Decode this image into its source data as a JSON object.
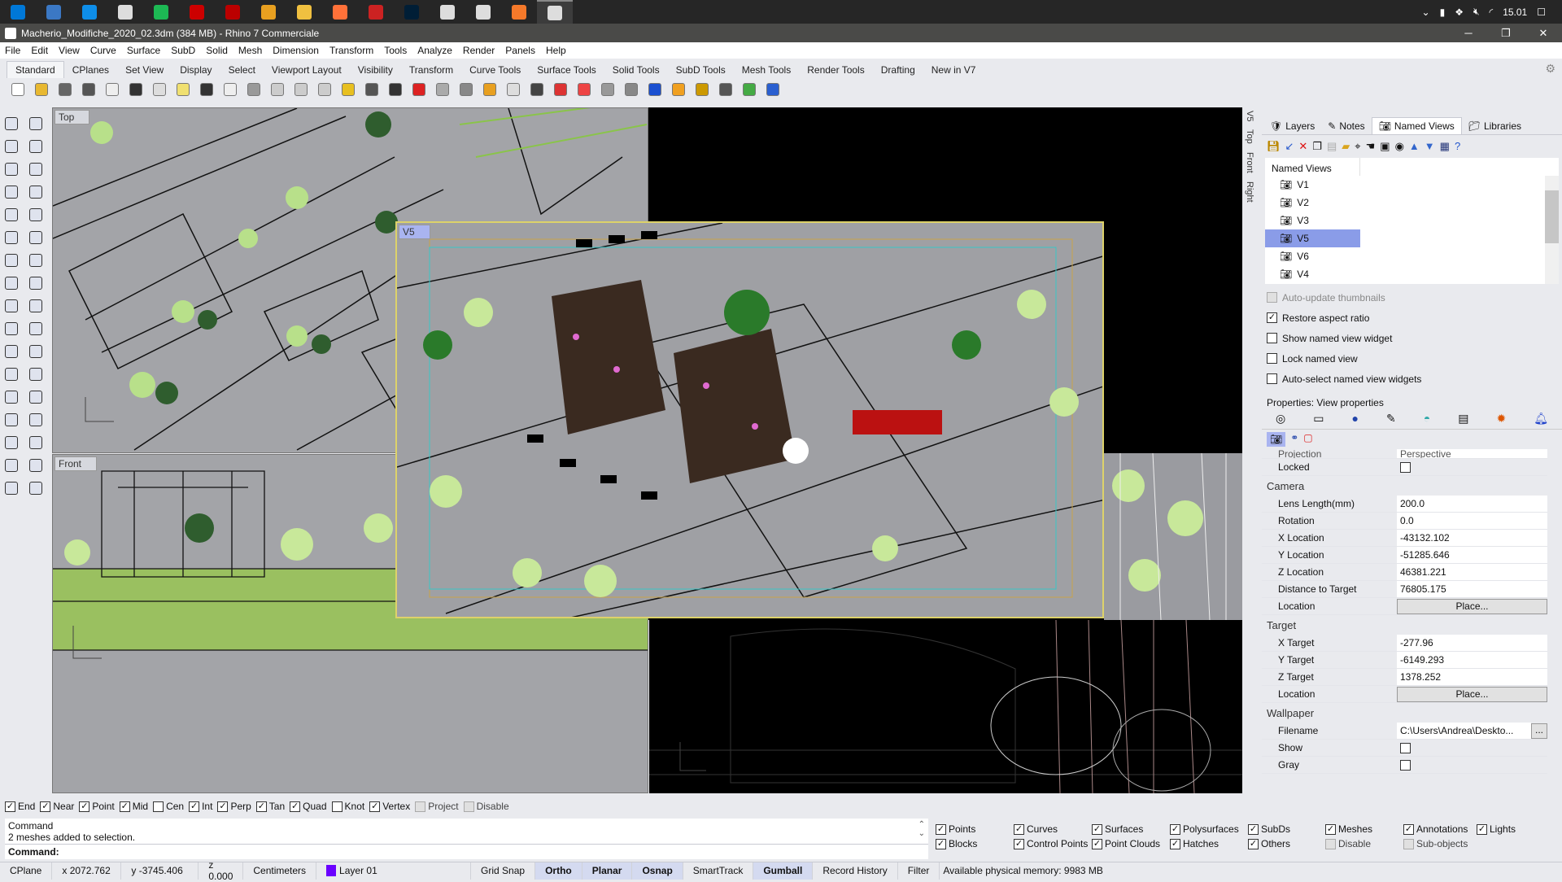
{
  "taskbar": {
    "icons": [
      "windows-start",
      "keyboard",
      "teamviewer",
      "remote-desktop",
      "spotify",
      "flash",
      "filezilla",
      "chrome",
      "file-explorer",
      "firefox",
      "rhino-render",
      "photoshop",
      "rhino-6",
      "rhino",
      "blender",
      "rhino-7"
    ],
    "tray_time": "15.01"
  },
  "window": {
    "title": "Macherio_Modifiche_2020_02.3dm (384 MB) - Rhino 7 Commerciale"
  },
  "menu": [
    "File",
    "Edit",
    "View",
    "Curve",
    "Surface",
    "SubD",
    "Solid",
    "Mesh",
    "Dimension",
    "Transform",
    "Tools",
    "Analyze",
    "Render",
    "Panels",
    "Help"
  ],
  "toolbar_tabs": [
    "Standard",
    "CPlanes",
    "Set View",
    "Display",
    "Select",
    "Viewport Layout",
    "Visibility",
    "Transform",
    "Curve Tools",
    "Surface Tools",
    "Solid Tools",
    "SubD Tools",
    "Mesh Tools",
    "Render Tools",
    "Drafting",
    "New in V7"
  ],
  "toolbar_icons": [
    "new",
    "open",
    "save",
    "print",
    "import",
    "cut",
    "copy",
    "paste",
    "undo",
    "pan",
    "rotate",
    "zoom",
    "zoom-window",
    "zoom-extents",
    "zoom-selected",
    "undo-view",
    "four-viewports",
    "car",
    "grid",
    "cplane",
    "gumball",
    "light",
    "lock",
    "layer",
    "color",
    "render-sphere",
    "shaded-sphere",
    "blue-sphere",
    "cone",
    "gear",
    "dimension",
    "globe",
    "help"
  ],
  "viewports": {
    "top": "Top",
    "front": "Front",
    "v5": "V5",
    "axis_x": "x",
    "axis_y": "y",
    "axis_z": "z"
  },
  "vertical_tabs": [
    "V5",
    "Top",
    "Front",
    "Right"
  ],
  "panel": {
    "tabs": [
      "Layers",
      "Notes",
      "Named Views",
      "Libraries"
    ],
    "list_header": "Named Views",
    "views": [
      "V1",
      "V2",
      "V3",
      "V5",
      "V6",
      "V4"
    ],
    "selected_view": "V5",
    "options": [
      {
        "label": "Auto-update thumbnails",
        "checked": false,
        "disabled": true
      },
      {
        "label": "Restore aspect ratio",
        "checked": true
      },
      {
        "label": "Show named view widget",
        "checked": false
      },
      {
        "label": "Lock named view",
        "checked": false
      },
      {
        "label": "Auto-select named view widgets",
        "checked": false
      }
    ],
    "properties_title": "Properties: View properties",
    "projection_label": "Projection",
    "projection_value": "Perspective",
    "locked_label": "Locked",
    "camera": {
      "title": "Camera",
      "lens_label": "Lens Length(mm)",
      "lens": "200.0",
      "rotation_label": "Rotation",
      "rotation": "0.0",
      "xloc_label": "X Location",
      "xloc": "-43132.102",
      "yloc_label": "Y Location",
      "yloc": "-51285.646",
      "zloc_label": "Z Location",
      "zloc": "46381.221",
      "dist_label": "Distance to Target",
      "dist": "76805.175",
      "location_label": "Location",
      "place": "Place..."
    },
    "target": {
      "title": "Target",
      "x_label": "X Target",
      "x": "-277.96",
      "y_label": "Y Target",
      "y": "-6149.293",
      "z_label": "Z Target",
      "z": "1378.252",
      "location_label": "Location",
      "place": "Place..."
    },
    "wallpaper": {
      "title": "Wallpaper",
      "filename_label": "Filename",
      "filename": "C:\\Users\\Andrea\\Deskto...",
      "browse": "...",
      "show_label": "Show",
      "gray_label": "Gray"
    }
  },
  "osnap": [
    {
      "label": "End",
      "checked": true
    },
    {
      "label": "Near",
      "checked": true
    },
    {
      "label": "Point",
      "checked": true
    },
    {
      "label": "Mid",
      "checked": true
    },
    {
      "label": "Cen",
      "checked": false
    },
    {
      "label": "Int",
      "checked": true
    },
    {
      "label": "Perp",
      "checked": true
    },
    {
      "label": "Tan",
      "checked": true
    },
    {
      "label": "Quad",
      "checked": true
    },
    {
      "label": "Knot",
      "checked": false
    },
    {
      "label": "Vertex",
      "checked": true
    },
    {
      "label": "Project",
      "checked": false,
      "disabled": true
    },
    {
      "label": "Disable",
      "checked": false,
      "disabled": true
    }
  ],
  "command": {
    "history": [
      "Command",
      "2 meshes added to selection."
    ],
    "prompt": "Command:"
  },
  "filter": [
    {
      "label": "Points",
      "checked": true
    },
    {
      "label": "Curves",
      "checked": true
    },
    {
      "label": "Surfaces",
      "checked": true
    },
    {
      "label": "Polysurfaces",
      "checked": true
    },
    {
      "label": "SubDs",
      "checked": true
    },
    {
      "label": "Meshes",
      "checked": true
    },
    {
      "label": "Annotations",
      "checked": true
    },
    {
      "label": "Lights",
      "checked": true
    },
    {
      "label": "Blocks",
      "checked": true
    },
    {
      "label": "Control Points",
      "checked": true
    },
    {
      "label": "Point Clouds",
      "checked": true
    },
    {
      "label": "Hatches",
      "checked": true
    },
    {
      "label": "Others",
      "checked": true
    },
    {
      "label": "Disable",
      "checked": false,
      "disabled": true
    },
    {
      "label": "Sub-objects",
      "checked": false,
      "disabled": true
    }
  ],
  "status": {
    "cplane": "CPlane",
    "x": "x 2072.762",
    "y": "y -3745.406",
    "z": "z 0.000",
    "units": "Centimeters",
    "layer": "Layer 01",
    "layer_color": "#6a00ff",
    "grid_snap": "Grid Snap",
    "ortho": "Ortho",
    "planar": "Planar",
    "osnap": "Osnap",
    "smarttrack": "SmartTrack",
    "gumball": "Gumball",
    "record_history": "Record History",
    "filter": "Filter",
    "memory": "Available physical memory: 9983 MB"
  }
}
